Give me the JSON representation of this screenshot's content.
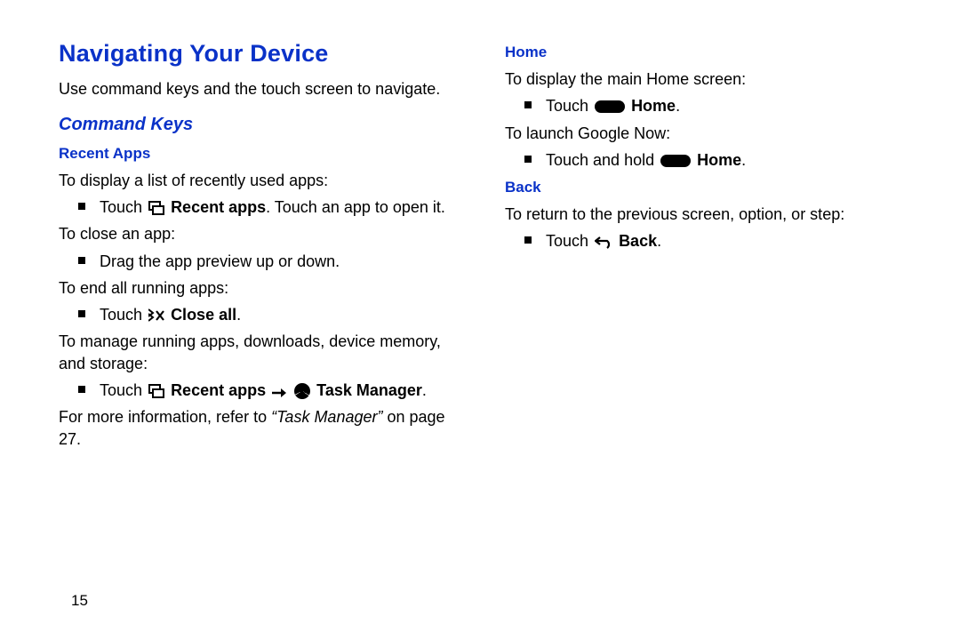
{
  "page_number": "15",
  "title": "Navigating Your Device",
  "intro": "Use command keys and the touch screen to navigate.",
  "subtitle": "Command Keys",
  "recent": {
    "heading": "Recent Apps",
    "p1": "To display a list of recently used apps:",
    "b1_pre": "Touch ",
    "b1_bold": "Recent apps",
    "b1_post": ". Touch an app to open it.",
    "p2": "To close an app:",
    "b2": "Drag the app preview up or down.",
    "p3": "To end all running apps:",
    "b3_pre": "Touch ",
    "b3_bold": "Close all",
    "b3_post": ".",
    "p4": "To manage running apps, downloads, device memory, and storage:",
    "b4_pre": "Touch ",
    "b4_bold1": "Recent apps",
    "b4_mid": " ",
    "b4_bold2": "Task Manager",
    "b4_post": ".",
    "p5_pre": "For more information, refer to ",
    "p5_ital": "“Task Manager”",
    "p5_post": " on page 27."
  },
  "home": {
    "heading": "Home",
    "p1": "To display the main Home screen:",
    "b1_pre": "Touch ",
    "b1_bold": "Home",
    "b1_post": ".",
    "p2": "To launch Google Now:",
    "b2_pre": "Touch and hold ",
    "b2_bold": "Home",
    "b2_post": "."
  },
  "back": {
    "heading": "Back",
    "p1": "To return to the previous screen, option, or step:",
    "b1_pre": "Touch ",
    "b1_bold": "Back",
    "b1_post": "."
  }
}
